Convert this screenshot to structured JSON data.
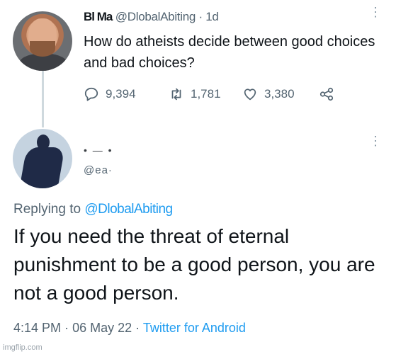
{
  "tweet1": {
    "author_name": "Bl   Ma",
    "handle": "@DlobalAbiting",
    "time": "1d",
    "text": "How do atheists decide between good choices and bad choices?",
    "stats": {
      "replies": "9,394",
      "retweets": "1,781",
      "likes": "3,380"
    }
  },
  "tweet2": {
    "author_name": "• — •",
    "handle": "@ea·",
    "replying_label": "Replying to",
    "replying_handle": "@DlobalAbiting",
    "text": "If you need the threat of eternal punishment to be a good person, you are not a good person.",
    "time": "4:14 PM",
    "date": "06 May 22",
    "source": "Twitter for Android"
  },
  "separator": "·",
  "more_glyph": "⋮",
  "watermark": "imgflip.com",
  "icons": {
    "reply": "reply-icon",
    "retweet": "retweet-icon",
    "like": "like-icon",
    "share": "share-icon",
    "more": "more-options-icon"
  },
  "colors": {
    "link": "#1d9bf0",
    "muted": "#536471",
    "text": "#0f1419"
  }
}
